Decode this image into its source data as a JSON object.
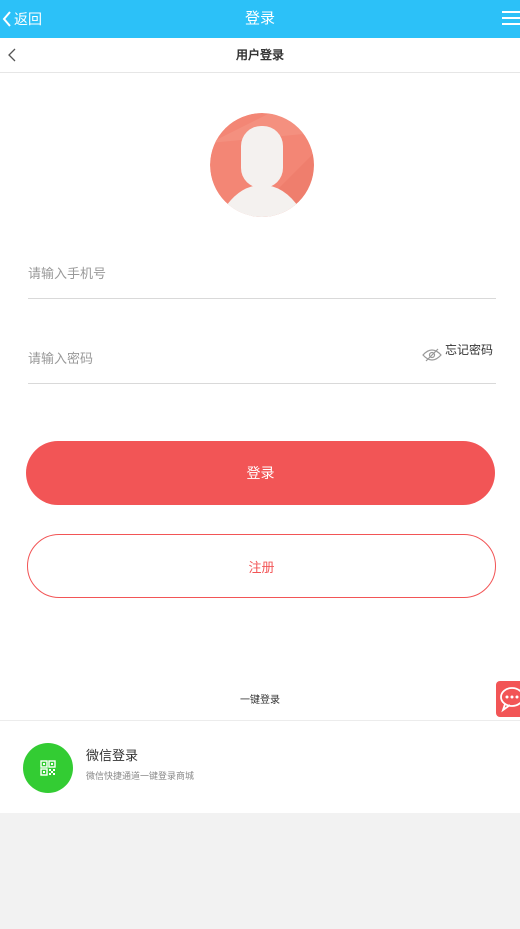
{
  "topbar": {
    "back_label": "返回",
    "title": "登录"
  },
  "subheader": {
    "title": "用户登录"
  },
  "login_form": {
    "phone_placeholder": "请输入手机号",
    "password_placeholder": "请输入密码",
    "forgot_label": "忘记密码",
    "login_button": "登录",
    "register_button": "注册"
  },
  "onekey_label": "一键登录",
  "wechat": {
    "title": "微信登录",
    "subtitle": "微信快捷通道一键登录商城"
  },
  "colors": {
    "topbar": "#2cc1f8",
    "accent": "#f25556",
    "wechat": "#33cc33",
    "avatar": "#f38675"
  }
}
